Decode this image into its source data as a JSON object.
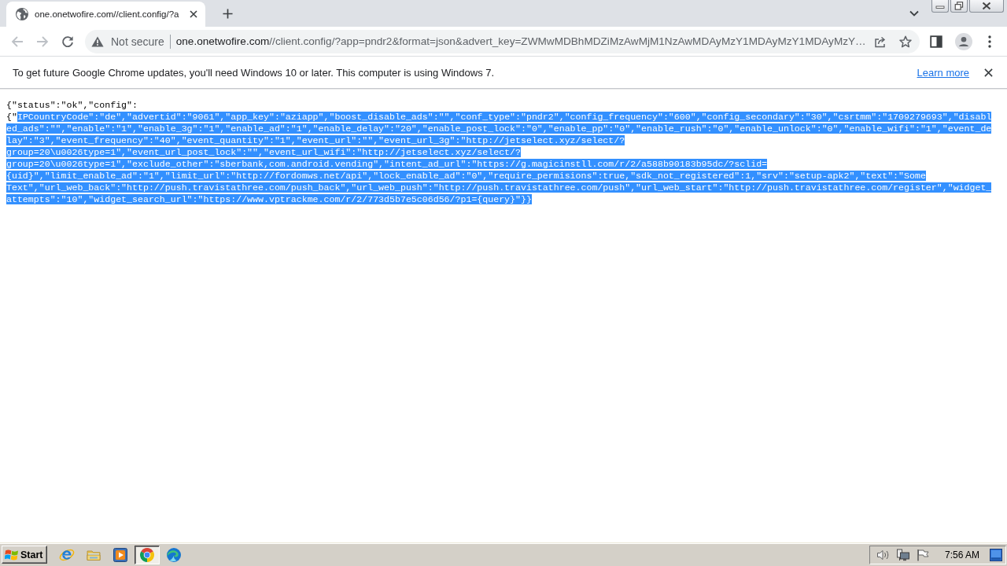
{
  "browser": {
    "tabs": [
      {
        "title": "one.onetwofire.com//client.config/?a",
        "selected": true
      }
    ],
    "toolbar": {
      "back": {
        "disabled": true
      },
      "forward": {
        "disabled": true
      },
      "security_label": "Not secure",
      "url_host": "one.onetwofire.com",
      "url_path": "//client.config/?app=pndr2&format=json&advert_key=ZWMwMDBhMDZiMzAwMjM1NzAwMDAyMzY1MDAyMzY1MDAyMzY…"
    },
    "infobar": {
      "message": "To get future Google Chrome updates, you'll need Windows 10 or later. This computer is using Windows 7.",
      "link": "Learn more"
    }
  },
  "page": {
    "lines": [
      [
        {
          "text": "{\"status\":\"ok\",\"config\":",
          "selected": false
        }
      ],
      [
        {
          "text": "{\"",
          "selected": false
        },
        {
          "text": "IPCountryCode\":\"de\",\"advertid\":\"9061\",\"app_key\":\"aziapp\",\"boost_disable_ads\":\"\",\"conf_type\":\"pndr2\",\"config_frequency\":\"600\",\"config_secondary\":\"30\",\"csrtmm\":\"1709279693\",\"disabl",
          "selected": true
        }
      ],
      [
        {
          "text": "ed_ads\":\"\",\"enable\":\"1\",\"enable_3g\":\"1\",\"enable_ad\":\"1\",\"enable_delay\":\"20\",\"enable_post_lock\":\"0\",\"enable_pp\":\"0\",\"enable_rush\":\"0\",\"enable_unlock\":\"0\",\"enable_wifi\":\"1\",\"event_de",
          "selected": true
        }
      ],
      [
        {
          "text": "lay\":\"3\",\"event_frequency\":\"40\",\"event_quantity\":\"1\",\"event_url\":\"\",\"event_url_3g\":\"http://jetselect.xyz/select/?",
          "selected": true
        }
      ],
      [
        {
          "text": "group=20\\u0026type=1\",\"event_url_post_lock\":\"\",\"event_url_wifi\":\"http://jetselect.xyz/select/?",
          "selected": true
        }
      ],
      [
        {
          "text": "group=20\\u0026type=1\",\"exclude_other\":\"sberbank,com.android.vending\",\"intent_ad_url\":\"https://g.magicinstll.com/r/2/a588b90183b95dc/?sclid=",
          "selected": true
        }
      ],
      [
        {
          "text": "{uid}\",\"limit_enable_ad\":\"1\",\"limit_url\":\"http://fordomws.net/api\",\"lock_enable_ad\":\"0\",\"require_permisions\":true,\"sdk_not_registered\":1,\"srv\":\"setup-apk2\",\"text\":\"Some",
          "selected": true
        }
      ],
      [
        {
          "text": "Text\",\"url_web_back\":\"http://push.travistathree.com/push_back\",\"url_web_push\":\"http://push.travistathree.com/push\",\"url_web_start\":\"http://push.travistathree.com/register\",\"widget_",
          "selected": true
        }
      ],
      [
        {
          "text": "attempts\":\"10\",\"widget_search_url\":\"https://www.vptrackme.com/r/2/773d5b7e5c06d56/?p1={query}\"}}",
          "selected": true
        }
      ]
    ]
  },
  "taskbar": {
    "start": "Start",
    "apps": [
      {
        "kind": "e-logo",
        "selected": false
      },
      {
        "kind": "folder",
        "selected": false
      },
      {
        "kind": "media-player",
        "selected": false
      },
      {
        "kind": "round-logo",
        "selected": true
      },
      {
        "kind": "wave-logo",
        "selected": false
      }
    ],
    "clock": "7:56 AM"
  }
}
